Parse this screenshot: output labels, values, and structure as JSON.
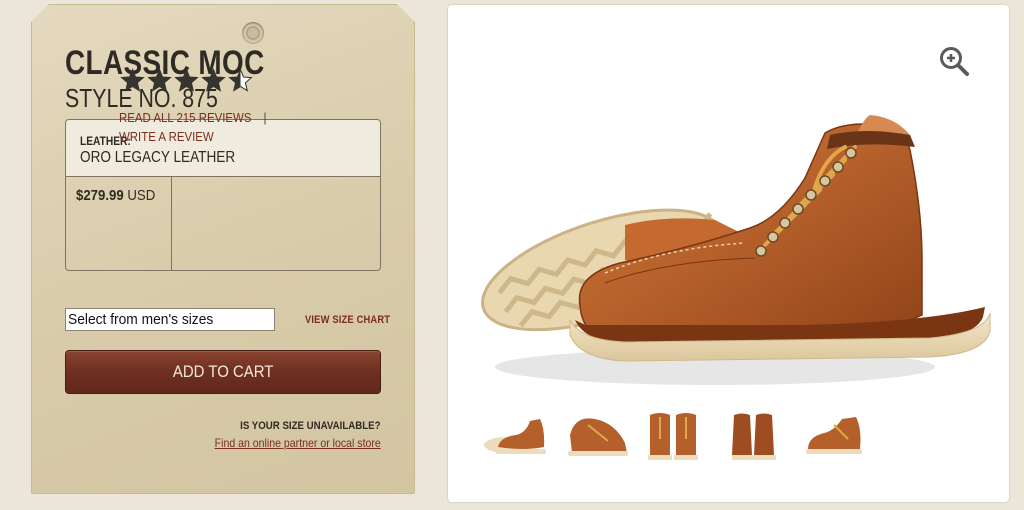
{
  "product": {
    "title": "CLASSIC MOC",
    "style": "STYLE NO. 875",
    "leather_label": "LEATHER:",
    "leather_value": "ORO LEGACY LEATHER",
    "price_amount": "$279.99",
    "price_currency": "USD",
    "rating": 4.5,
    "rating_max": 5,
    "reviews_link": "READ ALL 215 REVIEWS",
    "separator": "|",
    "write_review": "WRITE A REVIEW"
  },
  "size": {
    "select_value": "Select from men's sizes",
    "chart_link": "VIEW SIZE CHART"
  },
  "cart": {
    "add_label": "ADD TO CART"
  },
  "availability": {
    "question": "IS YOUR SIZE UNAVAILABLE?",
    "link": "Find an online partner or local store"
  },
  "gallery": {
    "zoom_icon": "zoom-in-icon",
    "thumbnails": [
      "side-profile",
      "three-quarter-front",
      "front-pair",
      "back-pair",
      "three-quarter-rear"
    ]
  },
  "colors": {
    "leather": "#b8622c",
    "button": "#6e2f21",
    "link": "#7a2e1e",
    "tag": "#d8cba9"
  }
}
